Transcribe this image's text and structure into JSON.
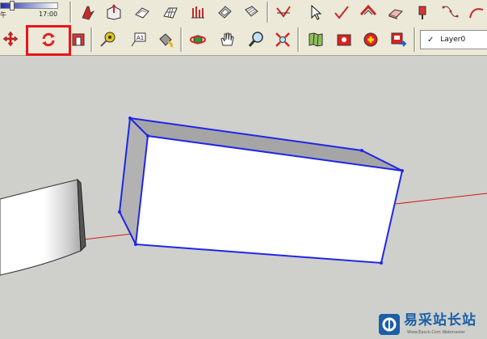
{
  "time_slider": {
    "left_label": "午",
    "right_label": "17:00"
  },
  "toolbar_row1": {
    "buttons": [
      {
        "name": "north-view-button",
        "icon": "arrow-up-icon"
      },
      {
        "name": "push-pull-button",
        "icon": "push-pull-icon"
      },
      {
        "name": "sandbox-from-contours-button",
        "icon": "contours-icon"
      },
      {
        "name": "sandbox-from-scratch-button",
        "icon": "grid-icon"
      },
      {
        "name": "smoove-button",
        "icon": "smoove-icon"
      },
      {
        "name": "stamp-button",
        "icon": "stamp-icon"
      },
      {
        "name": "drape-button",
        "icon": "drape-icon"
      },
      {
        "name": "add-detail-button",
        "icon": "add-detail-icon"
      },
      {
        "name": "select-tool-button",
        "icon": "cursor-icon"
      },
      {
        "name": "flip-edge-button",
        "icon": "flip-edge-icon"
      },
      {
        "name": "warehouse-button",
        "icon": "warehouse-icon"
      },
      {
        "name": "eraser-button",
        "icon": "eraser-icon"
      },
      {
        "name": "rotate-3d-button",
        "icon": "rotate-3d-icon"
      },
      {
        "name": "follow-me-button",
        "icon": "follow-me-icon"
      },
      {
        "name": "arc-tool-button",
        "icon": "arc-icon"
      }
    ]
  },
  "toolbar_row2": {
    "highlighted": "rotate-button",
    "buttons": [
      {
        "name": "move-button",
        "icon": "move-arrows-icon"
      },
      {
        "name": "rotate-button",
        "icon": "rotate-icon"
      },
      {
        "name": "scale-button",
        "icon": "scale-icon"
      },
      {
        "name": "tape-measure-button",
        "icon": "tape-measure-icon"
      },
      {
        "name": "text-button",
        "icon": "text-a1-icon"
      },
      {
        "name": "paint-bucket-button",
        "icon": "paint-bucket-icon"
      },
      {
        "name": "orbit-button",
        "icon": "orbit-icon"
      },
      {
        "name": "pan-button",
        "icon": "hand-icon"
      },
      {
        "name": "zoom-button",
        "icon": "magnifier-icon"
      },
      {
        "name": "zoom-extents-button",
        "icon": "zoom-extents-icon"
      },
      {
        "name": "get-models-button",
        "icon": "map-icon"
      },
      {
        "name": "share-model-button",
        "icon": "share-icon"
      },
      {
        "name": "components-button",
        "icon": "component-icon"
      },
      {
        "name": "send-to-layout-button",
        "icon": "send-icon"
      }
    ]
  },
  "layer": {
    "check": "✓",
    "name": "Layer0"
  },
  "watermark": {
    "text": "易采站长站",
    "sub": "Www.Easck.Com Webmaster"
  },
  "colors": {
    "toolbar_bg": "#ece9d8",
    "viewport_bg": "#cfcfcb",
    "selection_blue": "#1f26e6",
    "axis_red": "#d11a1a",
    "highlight_red": "#e8141b"
  }
}
